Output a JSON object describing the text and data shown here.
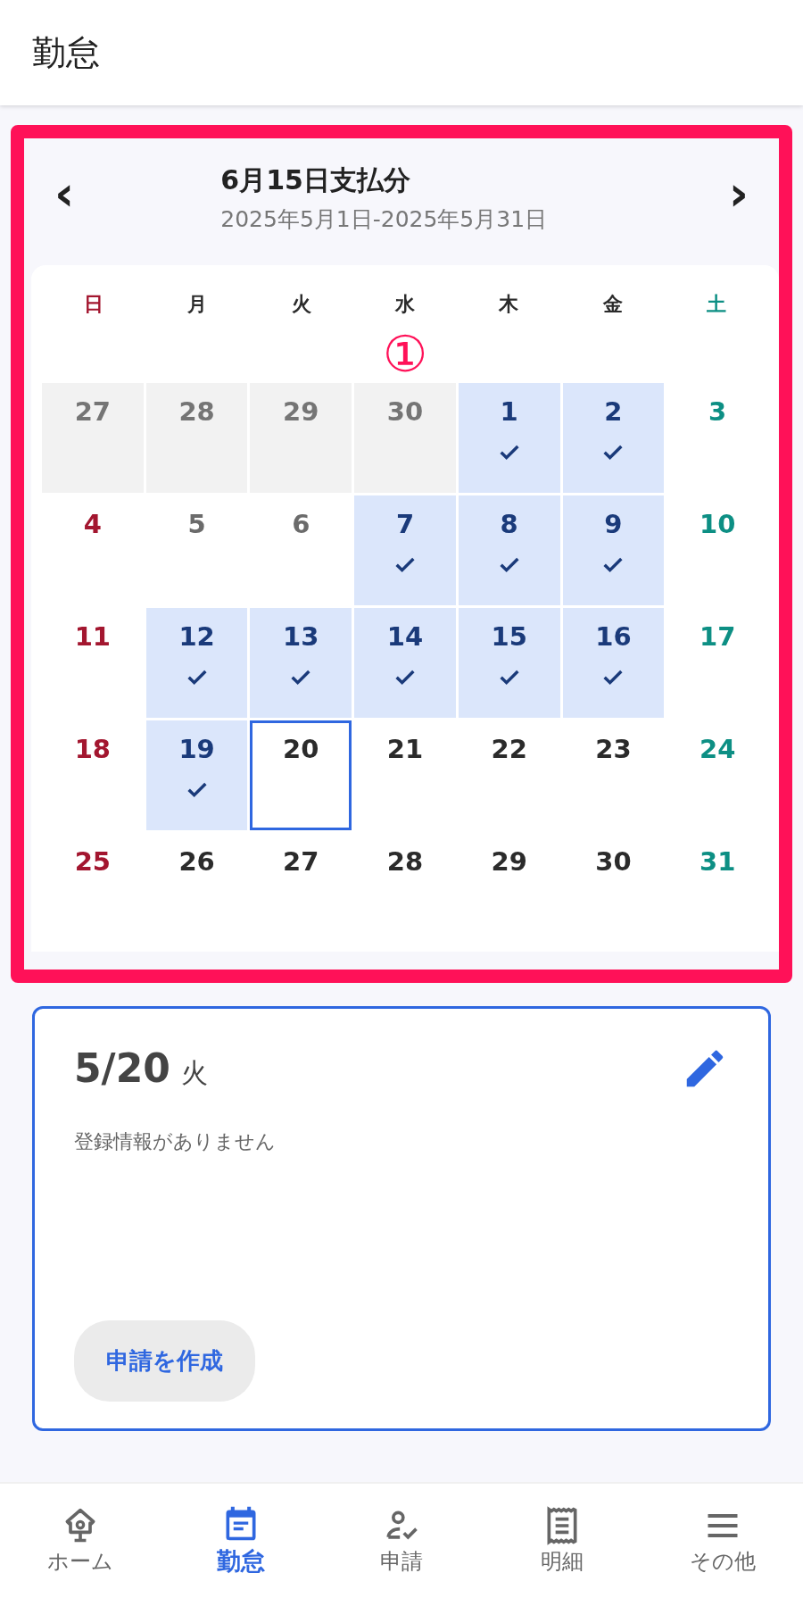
{
  "app_bar": {
    "title": "勤怠"
  },
  "period": {
    "title": "6月15日支払分",
    "range": "2025年5月1日-2025年5月31日",
    "prev": "‹",
    "next": "›"
  },
  "annotation": {
    "label": "①"
  },
  "weekdays": [
    "日",
    "月",
    "火",
    "水",
    "木",
    "金",
    "土"
  ],
  "days": [
    {
      "day": "27",
      "kind": "outside",
      "checked": false,
      "selected": false
    },
    {
      "day": "28",
      "kind": "outside",
      "checked": false,
      "selected": false
    },
    {
      "day": "29",
      "kind": "outside",
      "checked": false,
      "selected": false
    },
    {
      "day": "30",
      "kind": "outside",
      "checked": false,
      "selected": false
    },
    {
      "day": "1",
      "kind": "registered",
      "checked": true,
      "selected": false
    },
    {
      "day": "2",
      "kind": "registered",
      "checked": true,
      "selected": false
    },
    {
      "day": "3",
      "kind": "past",
      "checked": false,
      "selected": false
    },
    {
      "day": "4",
      "kind": "past",
      "checked": false,
      "selected": false
    },
    {
      "day": "5",
      "kind": "past",
      "checked": false,
      "selected": false
    },
    {
      "day": "6",
      "kind": "past",
      "checked": false,
      "selected": false
    },
    {
      "day": "7",
      "kind": "registered",
      "checked": true,
      "selected": false
    },
    {
      "day": "8",
      "kind": "registered",
      "checked": true,
      "selected": false
    },
    {
      "day": "9",
      "kind": "registered",
      "checked": true,
      "selected": false
    },
    {
      "day": "10",
      "kind": "past",
      "checked": false,
      "selected": false
    },
    {
      "day": "11",
      "kind": "past",
      "checked": false,
      "selected": false
    },
    {
      "day": "12",
      "kind": "registered",
      "checked": true,
      "selected": false
    },
    {
      "day": "13",
      "kind": "registered",
      "checked": true,
      "selected": false
    },
    {
      "day": "14",
      "kind": "registered",
      "checked": true,
      "selected": false
    },
    {
      "day": "15",
      "kind": "registered",
      "checked": true,
      "selected": false
    },
    {
      "day": "16",
      "kind": "registered",
      "checked": true,
      "selected": false
    },
    {
      "day": "17",
      "kind": "past",
      "checked": false,
      "selected": false
    },
    {
      "day": "18",
      "kind": "past",
      "checked": false,
      "selected": false
    },
    {
      "day": "19",
      "kind": "registered",
      "checked": true,
      "selected": false
    },
    {
      "day": "20",
      "kind": "upcoming",
      "checked": false,
      "selected": true
    },
    {
      "day": "21",
      "kind": "upcoming",
      "checked": false,
      "selected": false
    },
    {
      "day": "22",
      "kind": "upcoming",
      "checked": false,
      "selected": false
    },
    {
      "day": "23",
      "kind": "upcoming",
      "checked": false,
      "selected": false
    },
    {
      "day": "24",
      "kind": "upcoming",
      "checked": false,
      "selected": false
    },
    {
      "day": "25",
      "kind": "upcoming",
      "checked": false,
      "selected": false
    },
    {
      "day": "26",
      "kind": "upcoming",
      "checked": false,
      "selected": false
    },
    {
      "day": "27",
      "kind": "upcoming",
      "checked": false,
      "selected": false
    },
    {
      "day": "28",
      "kind": "upcoming",
      "checked": false,
      "selected": false
    },
    {
      "day": "29",
      "kind": "upcoming",
      "checked": false,
      "selected": false
    },
    {
      "day": "30",
      "kind": "upcoming",
      "checked": false,
      "selected": false
    },
    {
      "day": "31",
      "kind": "upcoming",
      "checked": false,
      "selected": false
    }
  ],
  "detail": {
    "date": "5/20",
    "weekday": "火",
    "message": "登録情報がありません",
    "button": "申請を作成"
  },
  "nav": [
    {
      "label": "ホーム",
      "selected": false
    },
    {
      "label": "勤怠",
      "selected": true
    },
    {
      "label": "申請",
      "selected": false
    },
    {
      "label": "明細",
      "selected": false
    },
    {
      "label": "その他",
      "selected": false
    }
  ]
}
